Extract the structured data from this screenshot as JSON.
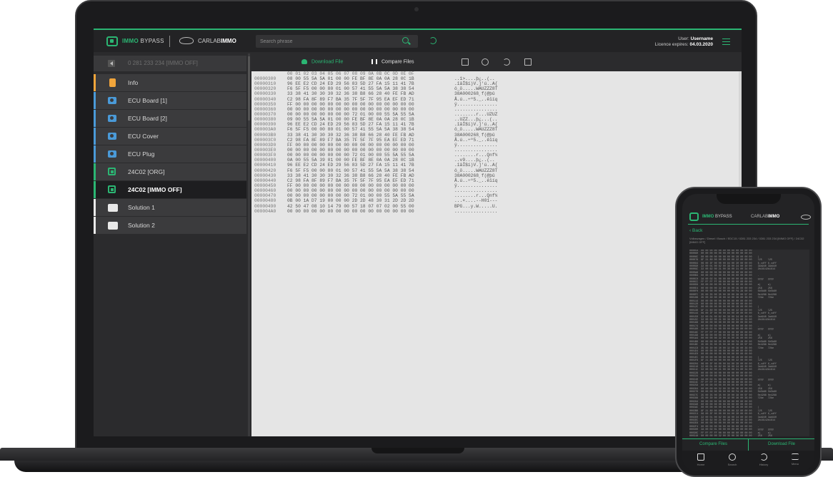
{
  "app": {
    "brand_prefix": "IMMO",
    "brand_suffix": " BYPASS",
    "partner_prefix": "CARLAB",
    "partner_suffix": "IMMO",
    "accent_color": "#2bb673"
  },
  "search": {
    "placeholder": "Search phrase"
  },
  "user": {
    "user_label": "User: ",
    "username": "Username",
    "licence_label": "Licence expires: ",
    "licence_date": "04.03.2020"
  },
  "sidebar": {
    "breadcrumb": "0 281 233 234 [IMMO OFF]",
    "items": [
      {
        "label": "Info",
        "icon": "document-icon"
      },
      {
        "label": "ECU Board [1]",
        "icon": "camera-icon"
      },
      {
        "label": "ECU Board [2]",
        "icon": "camera-icon"
      },
      {
        "label": "ECU Cover",
        "icon": "camera-icon"
      },
      {
        "label": "ECU Plug",
        "icon": "camera-icon"
      },
      {
        "label": "24C02 [ORG]",
        "icon": "chip-icon"
      },
      {
        "label": "24C02 [IMMO OFF]",
        "icon": "chip-icon",
        "active": true
      },
      {
        "label": "Solution 1",
        "icon": "folder-icon"
      },
      {
        "label": "Solution 2",
        "icon": "folder-icon"
      }
    ]
  },
  "toolbar": {
    "download_label": "Download File",
    "compare_label": "Compare Files"
  },
  "hex": {
    "header": "00 01 02 03 04 05 06 07 08 09 0A 0B 0C 0D 0E 0F",
    "rows": [
      {
        "addr": "00000300",
        "bytes": "08 00 55 5A 5A 01 00 00 FE BF 8E 0A 0A 28 0C 1B",
        "ascii": "..1>....þ¿..(.."
      },
      {
        "addr": "00000310",
        "bytes": "96 EE E2 CD 24 ED 29 56 83 5D 27 FA 15 11 41 7B",
        "ascii": ".îâÍ$í)V.]'ú..A{"
      },
      {
        "addr": "00000320",
        "bytes": "F6 5F F5 00 00 80 01 00 57 41 55 5A 5A 38 38 54",
        "ascii": "ö_õ.....WAUZZZ8T"
      },
      {
        "addr": "00000330",
        "bytes": "33 38 41 30 30 30 32 36 38 B8 66 28 40 FE FB AD",
        "ascii": "38A000268¸f(@þû­"
      },
      {
        "addr": "00000340",
        "bytes": "C2 98 FA 8F 89 F7 BA 35 7F 5F 7F 95 EA EF ED 71",
        "ascii": "Â.ú..÷º5._..êïíq"
      },
      {
        "addr": "00000350",
        "bytes": "FF 00 00 00 00 00 00 00 00 00 00 00 00 00 00 00",
        "ascii": "ÿ..............."
      },
      {
        "addr": "00000360",
        "bytes": "00 00 00 00 00 00 00 00 00 00 00 00 00 00 00 00",
        "ascii": "................"
      },
      {
        "addr": "00000370",
        "bytes": "00 00 00 00 00 00 00 00 72 01 00 00 55 5A 55 5A",
        "ascii": "........r...UZUZ"
      },
      {
        "addr": "00000380",
        "bytes": "09 00 55 5A 5A 01 00 00 FE BF 8E 0A 0A 28 0C 1B",
        "ascii": "..UZZ...þ¿...(.."
      },
      {
        "addr": "00000390",
        "bytes": "96 EE E2 CD 24 ED 29 56 83 5D 27 FA 15 11 41 7B",
        "ascii": ".îâÍ$í)V.]'ú..A{"
      },
      {
        "addr": "000003A0",
        "bytes": "F6 5F F5 00 00 80 01 00 57 41 55 5A 5A 38 38 54",
        "ascii": "ö_õ.....WAUZZZ8T"
      },
      {
        "addr": "000003B0",
        "bytes": "33 38 41 30 30 30 32 36 38 B8 66 28 40 FE FB AD",
        "ascii": "38A000268¸f(@þû­"
      },
      {
        "addr": "000003C0",
        "bytes": "C2 98 FA 8F 89 F7 BA 35 7F 5F 7F 95 EA EF ED 71",
        "ascii": "Â.ú..÷º5._..êïíq"
      },
      {
        "addr": "000003D0",
        "bytes": "FF 00 00 00 00 00 00 00 00 00 00 00 00 00 00 00",
        "ascii": "ÿ..............."
      },
      {
        "addr": "000003E0",
        "bytes": "00 00 00 00 00 00 00 00 00 00 00 00 00 00 00 00",
        "ascii": "................"
      },
      {
        "addr": "000003F0",
        "bytes": "00 00 00 00 00 00 00 00 72 01 00 00 55 5A 55 5A",
        "ascii": "........r...Qnf¼"
      },
      {
        "addr": "00000400",
        "bytes": "0A 00 55 5A 39 01 00 00 FE BF 8E 0A 0A 28 0C 1B",
        "ascii": "..v9....þ¿..(.."
      },
      {
        "addr": "00000410",
        "bytes": "96 EE E2 CD 24 ED 29 56 83 5D 27 FA 15 11 41 7B",
        "ascii": ".îâÍ$í)V.]'ú..A{"
      },
      {
        "addr": "00000420",
        "bytes": "F6 5F F5 00 00 80 01 00 57 41 55 5A 5A 38 38 54",
        "ascii": "ö_õ.....WAUZZZ8T"
      },
      {
        "addr": "00000430",
        "bytes": "33 38 41 30 30 30 32 36 38 B8 66 28 40 FE FB AD",
        "ascii": "38A000268¸f(@þû­"
      },
      {
        "addr": "00000440",
        "bytes": "C2 98 FA 8F 89 F7 BA 35 7F 5F 7F 95 EA EF ED 71",
        "ascii": "Â.ú..÷º5._..êïíq"
      },
      {
        "addr": "00000450",
        "bytes": "FF 00 00 00 00 00 00 00 00 00 00 00 00 00 00 00",
        "ascii": "ÿ..............."
      },
      {
        "addr": "00000460",
        "bytes": "00 00 00 00 00 00 00 00 00 00 00 00 00 00 00 00",
        "ascii": "................"
      },
      {
        "addr": "00000470",
        "bytes": "00 00 00 00 00 00 00 00 72 01 00 00 55 5A 55 5A",
        "ascii": "........r...Qnf¼"
      },
      {
        "addr": "00000480",
        "bytes": "0B 00 1A D7 19 00 00 00 2D 2D 48 30 31 2D 2D 2D",
        "ascii": "...×....--H01---"
      },
      {
        "addr": "00000490",
        "bytes": "42 50 47 08 10 14 79 00 57 18 07 07 02 00 55 00",
        "ascii": "BPG...y.W.....U."
      },
      {
        "addr": "000004A0",
        "bytes": "00 00 00 00 00 00 00 00 00 00 00 00 00 00 00 00",
        "ascii": "................"
      }
    ]
  },
  "phone": {
    "brand_prefix": "IMMO",
    "brand_suffix": " BYPASS",
    "partner_prefix": "CARLAB",
    "partner_suffix": "IMMO",
    "back_label": "Back",
    "breadcrumb": "Volkswagen / Diesel / Bosch / EDC15 / 0281 233 234 / 0281 233 234 [IMMO OFF] / 24C02 [IMMO OFF]",
    "hex_rows": [
      "000054  00 00 00 00 00 00 00 00 00 00 00 00",
      "000060  00 00 00 00 00 00 00 00 00 00 00 00",
      "00006C  00 00 00 00 00 00 00 00 28 00 00 00    |",
      "000078  9F 21 80 00 00 00 00 00 32 00 00 00    l25    l25",
      "000084  06 00 3F 00 00 00 84 00 30 00 00 00    6_cdff 6_cdff",
      "000090  32 00 01 00 62 00 39 00 34 00 30 00    3ab940 3ab940",
      "00009C  32 00 62 00 21 00 36 00 31 00 34 00    2b16142b1614",
      "0000A8  00 00 00 00 00 00 00 00 00 00 00 00",
      "0000B4  00 00 00 00 00 00 00 00 00 00 00 00    .",
      "0000C0  2A 00 02 01 00 00 00 00 00 00 00 00    yyyy   yyyy",
      "0000CC  FF FF FF FF 00 00 00 00 00 00 00 00",
      "0000D8  00 00 00 00 00 00 00 00 00 00 00 00    a)     a)",
      "0000E4  00 00 00 00 32 00 35 00 36 00 00 00    256    256",
      "0000F0  00 00 00 00 00 00 00 00 FA 28 00 00    5b5b80 5b5b80",
      "0000FC  35 00 35 00 35 00 30 00 38 00 5F 00    0e4288 0e4288",
      "000108  35 00 30 00 30 00 32 00 36 00 36 00    72be   72be",
      "000114  00 00 00 00 00 00 00 00 00 00 00 00",
      "000120  00 00 00 00 00 00 00 00 00 00 00 00",
      "00012C  00 00 00 00 00 00 00 00 28 00 00 00    |",
      "000138  9F 21 80 00 00 00 00 00 32 00 00 00    l25    l25",
      "000144  06 00 3F 00 00 00 84 00 30 00 00 00    6_cdff 6_cdff",
      "000150  32 00 01 00 62 00 39 00 34 00 30 00    3ab940 3ab940",
      "00015C  32 00 62 00 21 00 36 00 31 00 34 00    2b16142b1614",
      "000168  00 00 00 00 00 00 00 00 00 00 00 00",
      "000174  00 00 00 00 00 00 00 00 00 00 00 00    .",
      "000180  2A 00 02 01 00 00 00 00 00 00 00 00    yyyy   yyyy",
      "00018C  FF FF FF FF 00 00 00 00 00 00 00 00",
      "000198  00 00 00 00 00 00 00 00 00 00 00 00    a)     a)",
      "0001A4  00 00 00 00 32 00 35 00 36 00 00 00    256    256",
      "0001B0  00 00 00 00 00 00 00 00 FA 28 00 00    5b5b80 5b5b80",
      "0001BC  35 00 35 00 35 00 30 00 38 00 5F 00    0e4288 0e4288",
      "0001C8  35 00 30 00 30 00 32 00 36 00 36 00    72be   72be",
      "0001D4  00 00 00 00 00 00 00 00 00 00 00 00",
      "0001E0  00 00 00 00 00 00 00 00 00 00 00 00",
      "0001EC  00 00 00 00 00 00 00 00 28 00 00 00    |",
      "0001F8  9F 21 80 00 00 00 00 00 32 00 00 00    l25    l25",
      "000204  06 00 3F 00 00 00 84 00 30 00 00 00    6_cdff 6_cdff",
      "000210  32 00 01 00 62 00 39 00 34 00 30 00    3ab940 3ab940",
      "00021C  32 00 62 00 21 00 36 00 31 00 34 00    2b16142b1614",
      "000228  00 00 00 00 00 00 00 00 00 00 00 00",
      "000234  00 00 00 00 00 00 00 00 00 00 00 00    .",
      "000240  2A 00 02 01 00 00 00 00 00 00 00 00    yyyy   yyyy",
      "00024C  FF FF FF FF 00 00 00 00 00 00 00 00",
      "000258  00 00 00 00 00 00 00 00 00 00 00 00    a)     a)",
      "000264  00 00 00 00 32 00 35 00 36 00 00 00    256    256",
      "000270  00 00 00 00 00 00 00 00 FA 28 00 00    5b5b80 5b5b80",
      "00027C  35 00 35 00 35 00 30 00 38 00 5F 00    0e4288 0e4288",
      "000288  35 00 30 00 30 00 32 00 36 00 36 00    72be   72be",
      "000294  00 00 00 00 00 00 00 00 00 00 00 00",
      "0002A0  00 00 00 00 00 00 00 00 00 00 00 00",
      "0002AC  00 00 00 00 00 00 00 00 28 00 00 00    |",
      "0002B8  9F 21 80 00 00 00 00 00 32 00 00 00    l25    l25",
      "0002C4  06 00 3F 00 00 00 84 00 30 00 00 00    6_cdff 6_cdff",
      "0002D0  32 00 01 00 62 00 39 00 34 00 30 00    3ab940 3ab940",
      "0002DC  32 00 62 00 21 00 36 00 31 00 34 00    2b16142b1614",
      "0002E8  00 00 00 00 00 00 00 00 00 00 00 00",
      "0002F4  00 00 00 00 00 00 00 00 00 00 00 00    .",
      "000300  2A 00 02 01 00 00 00 00 00 00 00 00    yyyy   yyyy",
      "00030C  FF FF FF FF 00 00 00 00 00 00 00 00    a)     a)",
      "000318  00 00 00 00 32 00 35 00 36 00 00 00    256    256"
    ],
    "compare_tab": "Compare Files",
    "download_tab": "Download File",
    "nav": [
      {
        "label": "Home",
        "icon": "home-icon"
      },
      {
        "label": "Search",
        "icon": "search-icon"
      },
      {
        "label": "History",
        "icon": "history-icon"
      },
      {
        "label": "Menu",
        "icon": "menu-icon"
      }
    ]
  }
}
